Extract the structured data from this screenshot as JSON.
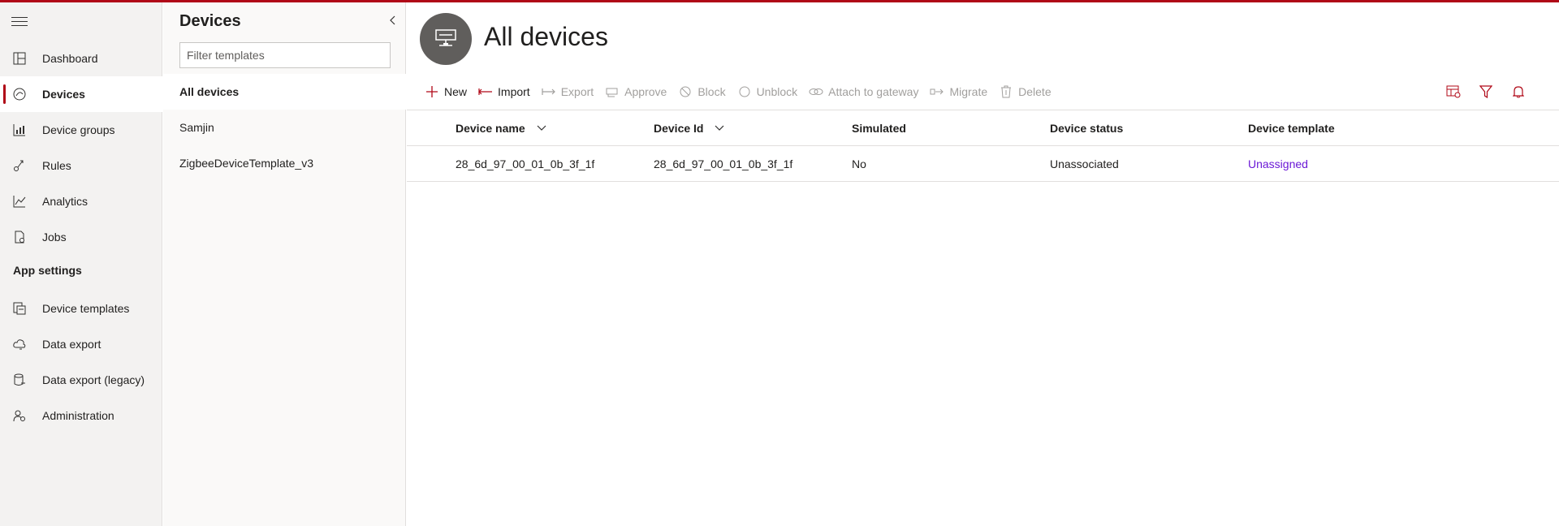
{
  "nav": {
    "items": [
      {
        "label": "Dashboard",
        "icon": "dashboard-icon"
      },
      {
        "label": "Devices",
        "icon": "devices-icon",
        "active": true
      },
      {
        "label": "Device groups",
        "icon": "device-groups-icon"
      },
      {
        "label": "Rules",
        "icon": "rules-icon"
      },
      {
        "label": "Analytics",
        "icon": "analytics-icon"
      },
      {
        "label": "Jobs",
        "icon": "jobs-icon"
      }
    ],
    "section": "App settings",
    "settings": [
      {
        "label": "Device templates",
        "icon": "device-templates-icon"
      },
      {
        "label": "Data export",
        "icon": "data-export-icon"
      },
      {
        "label": "Data export (legacy)",
        "icon": "data-export-legacy-icon"
      },
      {
        "label": "Administration",
        "icon": "administration-icon"
      }
    ]
  },
  "templates_pane": {
    "title": "Devices",
    "filter_placeholder": "Filter templates",
    "items": [
      {
        "label": "All devices",
        "active": true
      },
      {
        "label": "Samjin"
      },
      {
        "label": "ZigbeeDeviceTemplate_v3"
      }
    ]
  },
  "main": {
    "title": "All devices",
    "commands": [
      {
        "label": "New",
        "icon": "plus-icon",
        "enabled": true
      },
      {
        "label": "Import",
        "icon": "import-icon",
        "enabled": true
      },
      {
        "label": "Export",
        "icon": "export-icon",
        "enabled": false
      },
      {
        "label": "Approve",
        "icon": "approve-icon",
        "enabled": false
      },
      {
        "label": "Block",
        "icon": "block-icon",
        "enabled": false
      },
      {
        "label": "Unblock",
        "icon": "unblock-icon",
        "enabled": false
      },
      {
        "label": "Attach to gateway",
        "icon": "attach-gateway-icon",
        "enabled": false
      },
      {
        "label": "Migrate",
        "icon": "migrate-icon",
        "enabled": false
      },
      {
        "label": "Delete",
        "icon": "delete-icon",
        "enabled": false
      }
    ],
    "right_icons": [
      "edit-columns-icon",
      "filter-icon",
      "bell-icon"
    ],
    "table": {
      "columns": [
        "Device name",
        "Device Id",
        "Simulated",
        "Device status",
        "Device template"
      ],
      "rows": [
        [
          "28_6d_97_00_01_0b_3f_1f",
          "28_6d_97_00_01_0b_3f_1f",
          "No",
          "Unassociated",
          "Unassigned"
        ]
      ]
    }
  },
  "colors": {
    "accent": "#b00817",
    "link": "#6b18d6",
    "disabled": "#a19f9d"
  }
}
